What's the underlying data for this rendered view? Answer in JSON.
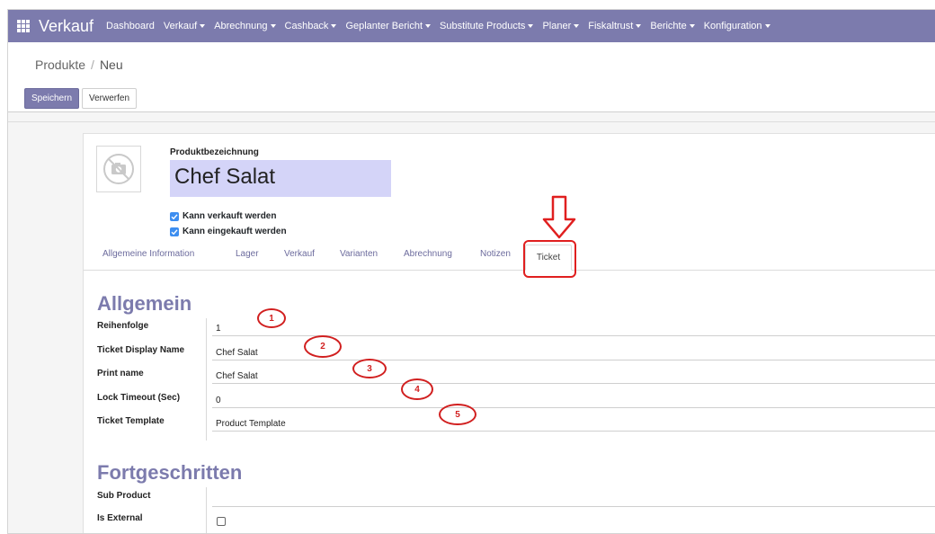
{
  "app": {
    "name": "Verkauf",
    "menu": [
      {
        "label": "Dashboard",
        "dropdown": false
      },
      {
        "label": "Verkauf",
        "dropdown": true
      },
      {
        "label": "Abrechnung",
        "dropdown": true
      },
      {
        "label": "Cashback",
        "dropdown": true
      },
      {
        "label": "Geplanter Bericht",
        "dropdown": true
      },
      {
        "label": "Substitute Products",
        "dropdown": true
      },
      {
        "label": "Planer",
        "dropdown": true
      },
      {
        "label": "Fiskaltrust",
        "dropdown": true
      },
      {
        "label": "Berichte",
        "dropdown": true
      },
      {
        "label": "Konfiguration",
        "dropdown": true
      }
    ],
    "nav_color": "#7c7bad"
  },
  "breadcrumb": {
    "parent": "Produkte",
    "separator": "/",
    "current": "Neu"
  },
  "actions": {
    "save_label": "Speichern",
    "discard_label": "Verwerfen"
  },
  "product": {
    "name_label": "Produktbezeichnung",
    "name_value": "Chef Salat",
    "can_be_sold": {
      "label": "Kann verkauft werden",
      "checked": true
    },
    "can_be_purchased": {
      "label": "Kann eingekauft werden",
      "checked": true
    }
  },
  "tabs": [
    {
      "label": "Allgemeine Information",
      "active": false
    },
    {
      "label": "Lager",
      "active": false
    },
    {
      "label": "Verkauf",
      "active": false
    },
    {
      "label": "Varianten",
      "active": false
    },
    {
      "label": "Abrechnung",
      "active": false
    },
    {
      "label": "Notizen",
      "active": false
    },
    {
      "label": "Ticket",
      "active": true
    }
  ],
  "sections": {
    "general": {
      "title": "Allgemein",
      "fields": [
        {
          "label": "Reihenfolge",
          "value": "1"
        },
        {
          "label": "Ticket Display Name",
          "value": "Chef Salat"
        },
        {
          "label": "Print name",
          "value": "Chef Salat"
        },
        {
          "label": "Lock Timeout (Sec)",
          "value": "0"
        },
        {
          "label": "Ticket Template",
          "value": "Product Template"
        }
      ]
    },
    "advanced": {
      "title": "Fortgeschritten",
      "sub_product": {
        "label": "Sub Product",
        "value": ""
      },
      "is_external": {
        "label": "Is External",
        "checked": false
      }
    }
  },
  "annotations": {
    "markers": [
      "1",
      "2",
      "3",
      "4",
      "5"
    ],
    "color": "#e01f1f"
  }
}
